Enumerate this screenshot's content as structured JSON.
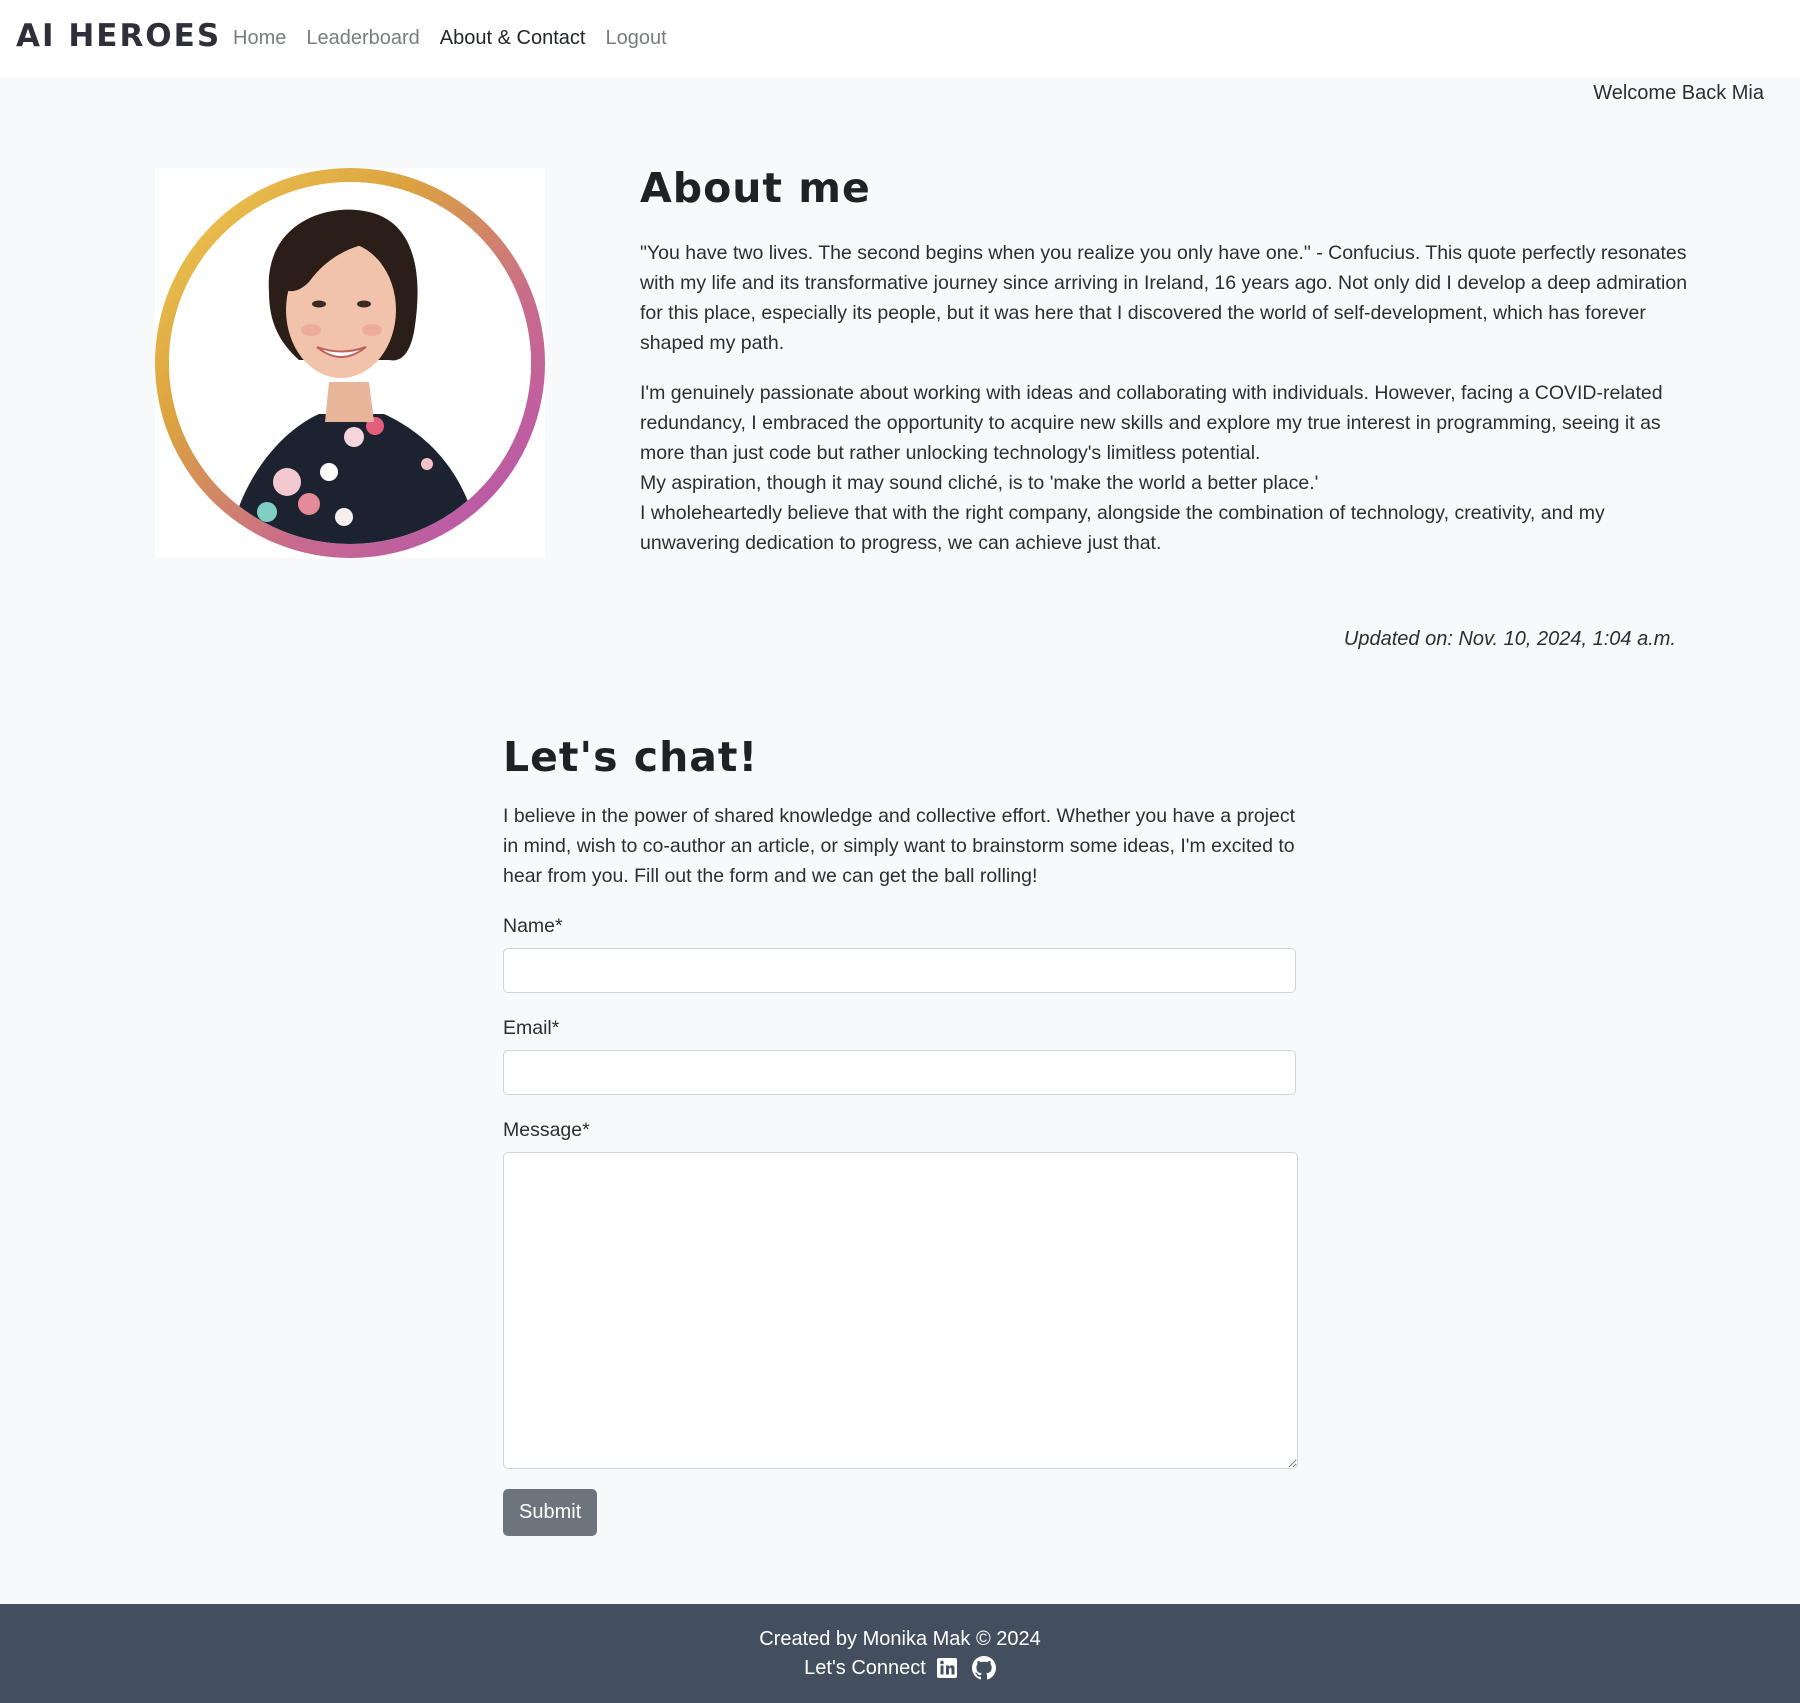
{
  "nav": {
    "brand": "AI HEROES",
    "links": [
      {
        "label": "Home"
      },
      {
        "label": "Leaderboard"
      },
      {
        "label": "About & Contact"
      },
      {
        "label": "Logout"
      }
    ],
    "welcome": "Welcome Back Mia"
  },
  "about": {
    "title": "About me",
    "p1": "\"You have two lives. The second begins when you realize you only have one.\" - Confucius. This quote perfectly resonates with my life and its transformative journey since arriving in Ireland, 16 years ago. Not only did I develop a deep admiration for this place, especially its people, but it was here that I discovered the world of self-development, which has forever shaped my path.",
    "p2a": " I'm genuinely passionate about working with ideas and collaborating with individuals. However, facing a COVID-related redundancy, I embraced the opportunity to acquire new skills and explore my true interest in programming, seeing it as more than just code but rather unlocking technology's limitless potential.",
    "p2b": "My aspiration, though it may sound cliché, is to 'make the world a better place.'",
    "p2c": "I wholeheartedly believe that with the right company, alongside the combination of technology, creativity, and my unwavering dedication to progress, we can achieve just that.",
    "updated": "Updated on: Nov. 10, 2024, 1:04 a.m."
  },
  "chat": {
    "title": "Let's chat!",
    "intro": "I believe in the power of shared knowledge and collective effort. Whether you have a project in mind, wish to co-author an article, or simply want to brainstorm some ideas, I'm excited to hear from you. Fill out the form and we can get the ball rolling!",
    "name_label": "Name*",
    "email_label": "Email*",
    "message_label": "Message*",
    "name_value": "",
    "email_value": "",
    "message_value": "",
    "submit_label": "Submit"
  },
  "footer": {
    "credit": "Created by Monika Mak © 2024",
    "connect": "Let's Connect",
    "icons": [
      "linkedin-icon",
      "github-icon"
    ]
  },
  "colors": {
    "background": "#f8f9fb",
    "footer": "#434f5f",
    "submit": "#6c757d",
    "ring_start": "#f0cc52",
    "ring_end": "#b24fb8"
  }
}
